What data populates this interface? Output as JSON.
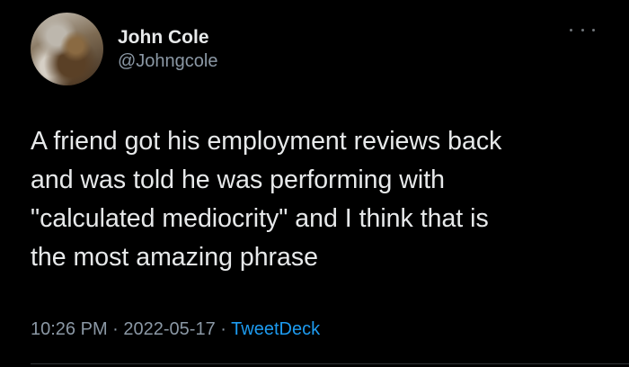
{
  "author": {
    "name": "John Cole",
    "handle": "@Johngcole"
  },
  "tweet": {
    "lines": [
      "A friend got his employment reviews back",
      "and was told he was performing with",
      "\"calculated mediocrity\" and I think that is",
      "the most amazing phrase"
    ],
    "time": "10:26 PM",
    "date": "2022-05-17",
    "separator": "·",
    "source": "TweetDeck"
  },
  "icons": {
    "more": "more-horizontal-icon"
  },
  "colors": {
    "background": "#000000",
    "text": "#e7e9ea",
    "muted": "#8b98a5",
    "link": "#1d9bf0"
  }
}
